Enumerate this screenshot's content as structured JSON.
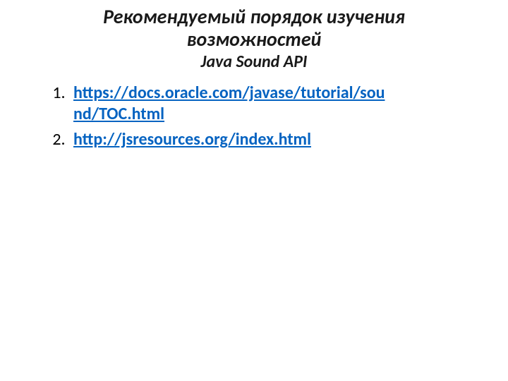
{
  "title": {
    "line1": "Рекомендуемый порядок изучения",
    "line2": "возможностей",
    "subtitle": "Java Sound API"
  },
  "links": {
    "item1": {
      "seg1": "https://docs.oracle.com/javase/tutorial/sou",
      "seg2": "nd/TOC.html"
    },
    "item2": "http://jsresources.org/index.html"
  }
}
